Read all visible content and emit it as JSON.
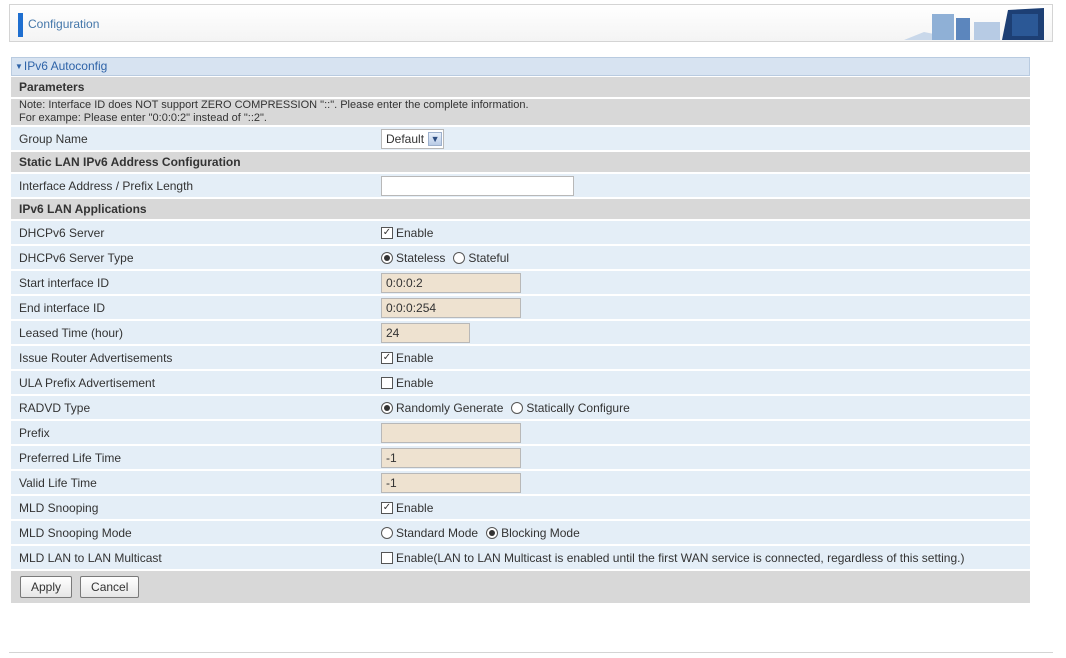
{
  "header": {
    "title": "Configuration"
  },
  "panel": {
    "title": "IPv6 Autoconfig"
  },
  "parameters": {
    "heading": "Parameters",
    "note_line1": "Note: Interface ID does NOT support ZERO COMPRESSION \"::\". Please enter the complete information.",
    "note_line2": "For exampe: Please enter \"0:0:0:2\" instead of \"::2\"."
  },
  "group_name": {
    "label": "Group Name",
    "value": "Default"
  },
  "static_lan": {
    "heading": "Static LAN IPv6 Address Configuration",
    "interface_label": "Interface Address / Prefix Length",
    "interface_value": ""
  },
  "apps": {
    "heading": "IPv6 LAN Applications",
    "dhcpv6_server": {
      "label": "DHCPv6 Server",
      "option": "Enable",
      "checked": true
    },
    "dhcpv6_type": {
      "label": "DHCPv6 Server Type",
      "options": [
        "Stateless",
        "Stateful"
      ],
      "selected": "Stateless"
    },
    "start_id": {
      "label": "Start interface ID",
      "value": "0:0:0:2"
    },
    "end_id": {
      "label": "End interface ID",
      "value": "0:0:0:254"
    },
    "leased_time": {
      "label": "Leased Time (hour)",
      "value": "24"
    },
    "issue_ra": {
      "label": "Issue Router Advertisements",
      "option": "Enable",
      "checked": true
    },
    "ula_prefix": {
      "label": "ULA Prefix Advertisement",
      "option": "Enable",
      "checked": false
    },
    "radvd_type": {
      "label": "RADVD Type",
      "options": [
        "Randomly Generate",
        "Statically Configure"
      ],
      "selected": "Randomly Generate"
    },
    "prefix": {
      "label": "Prefix",
      "value": ""
    },
    "preferred_life": {
      "label": "Preferred Life Time",
      "value": "-1"
    },
    "valid_life": {
      "label": "Valid Life Time",
      "value": "-1"
    },
    "mld_snooping": {
      "label": "MLD Snooping",
      "option": "Enable",
      "checked": true
    },
    "mld_mode": {
      "label": "MLD Snooping Mode",
      "options": [
        "Standard Mode",
        "Blocking Mode"
      ],
      "selected": "Blocking Mode"
    },
    "mld_lan": {
      "label": "MLD LAN to LAN Multicast",
      "option": "Enable(LAN to LAN Multicast is enabled until the first WAN service is connected, regardless of this setting.)",
      "checked": false
    }
  },
  "buttons": {
    "apply": "Apply",
    "cancel": "Cancel"
  },
  "colors": {
    "accent": "#1f6fd0",
    "row_bg": "#e4eef7",
    "section_bg": "#d8d8d8",
    "input_tan": "#eee2d0"
  }
}
